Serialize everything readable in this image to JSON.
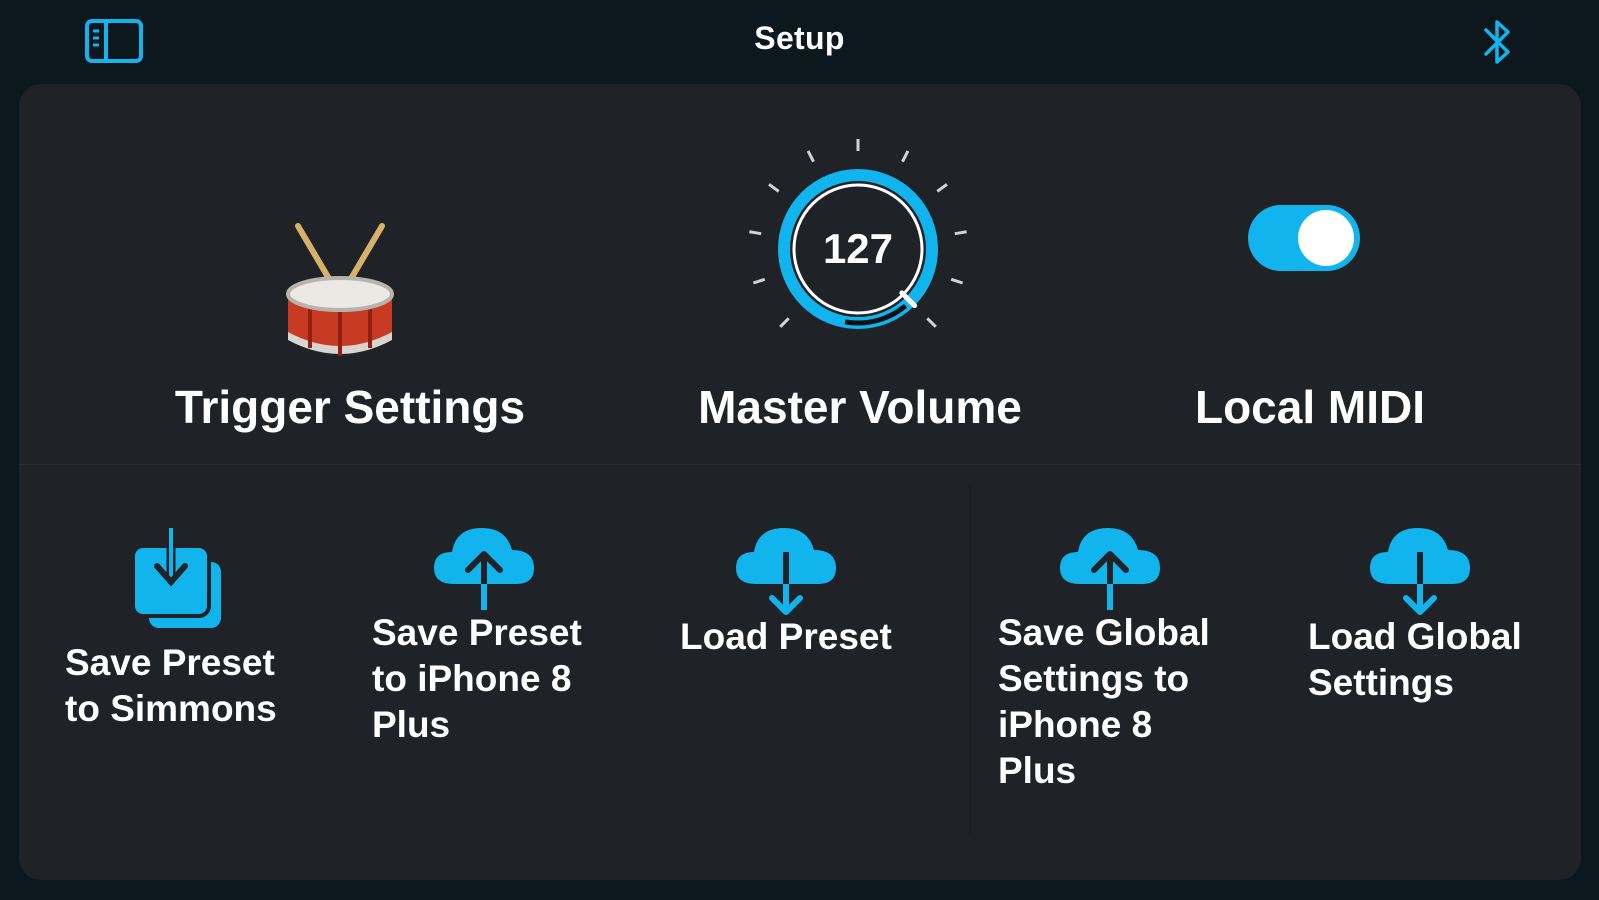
{
  "nav": {
    "title": "Setup",
    "sidebar_icon": "sidebar-toggle-icon",
    "bluetooth_icon": "bluetooth-icon"
  },
  "top_row": {
    "trigger": {
      "label": "Trigger Settings",
      "icon": "drum-icon"
    },
    "volume": {
      "label": "Master Volume",
      "value": "127",
      "level_fraction": 1.0
    },
    "midi": {
      "label": "Local MIDI",
      "enabled": true
    }
  },
  "actions": [
    {
      "label": "Save Preset\nto Simmons",
      "icon": "save-to-device-icon"
    },
    {
      "label": "Save Preset\nto iPhone 8\nPlus",
      "icon": "cloud-upload-icon"
    },
    {
      "label": "Load Preset",
      "icon": "cloud-download-icon"
    },
    {
      "label": "Save Global\nSettings to\niPhone 8\nPlus",
      "icon": "cloud-upload-icon"
    },
    {
      "label": "Load Global\nSettings",
      "icon": "cloud-download-icon"
    }
  ],
  "colors": {
    "accent": "#12b4ee",
    "background": "#0d171e",
    "panel": "#1f2327"
  }
}
